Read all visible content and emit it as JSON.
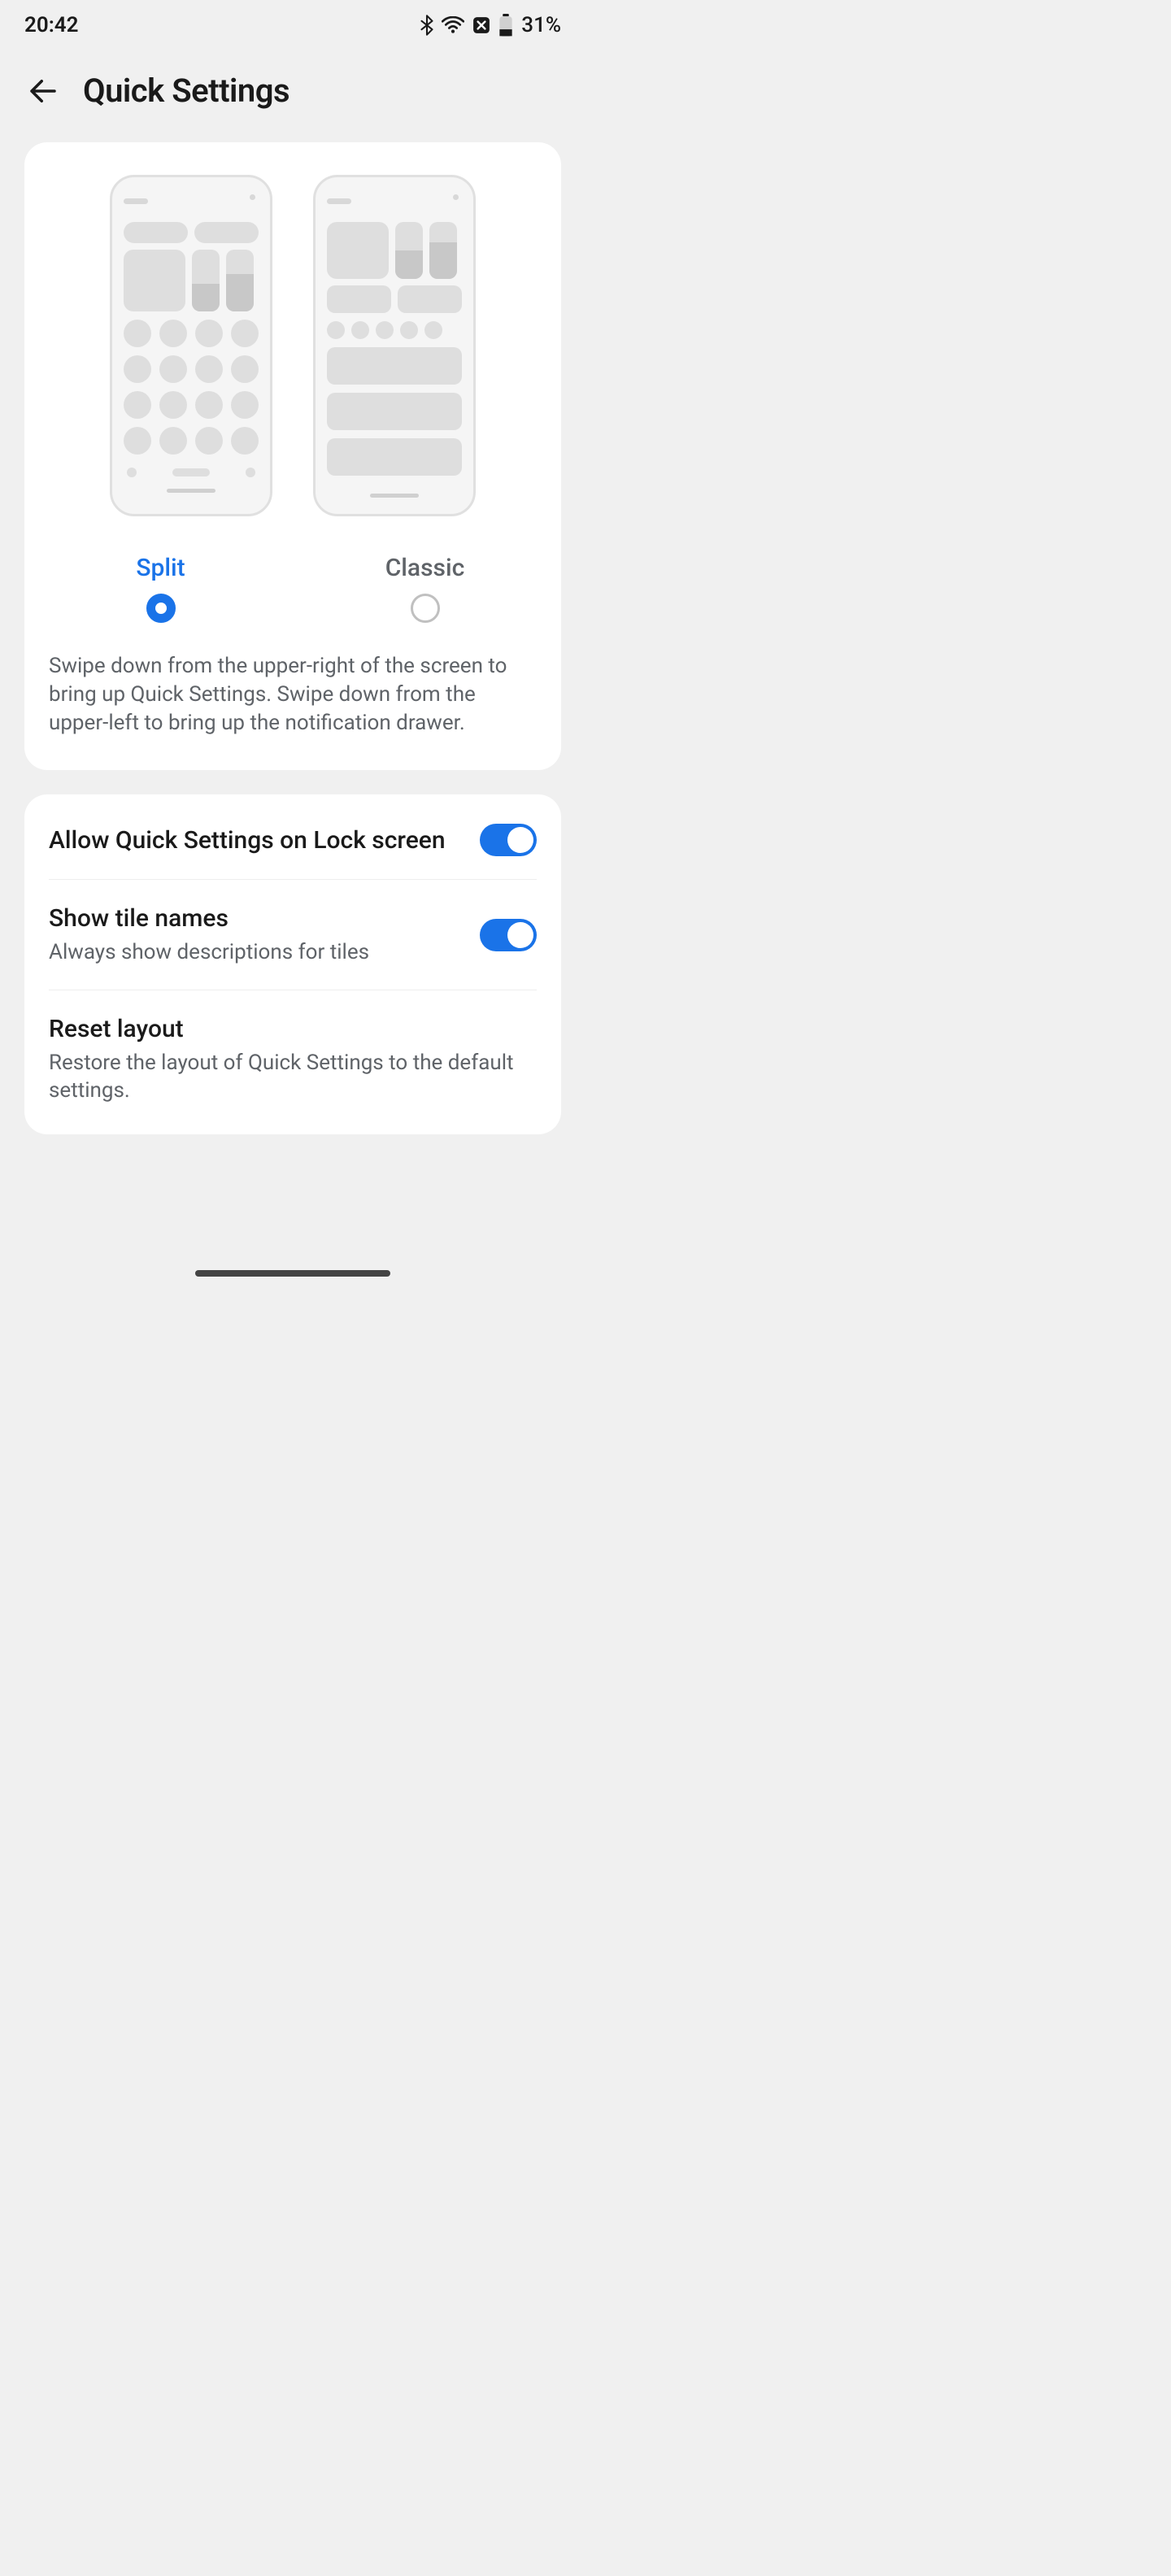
{
  "status": {
    "time": "20:42",
    "battery_pct": "31%"
  },
  "header": {
    "title": "Quick Settings"
  },
  "layout_picker": {
    "options": [
      {
        "label": "Split",
        "selected": true
      },
      {
        "label": "Classic",
        "selected": false
      }
    ],
    "description": "Swipe down from the upper-right of the screen to bring up Quick Settings. Swipe down from the upper-left to bring up the notification drawer."
  },
  "settings": {
    "allow_lock": {
      "title": "Allow Quick Settings on Lock screen",
      "enabled": true
    },
    "show_tile_names": {
      "title": "Show tile names",
      "subtitle": "Always show descriptions for tiles",
      "enabled": true
    },
    "reset_layout": {
      "title": "Reset layout",
      "subtitle": "Restore the layout of Quick Settings to the default settings."
    }
  }
}
